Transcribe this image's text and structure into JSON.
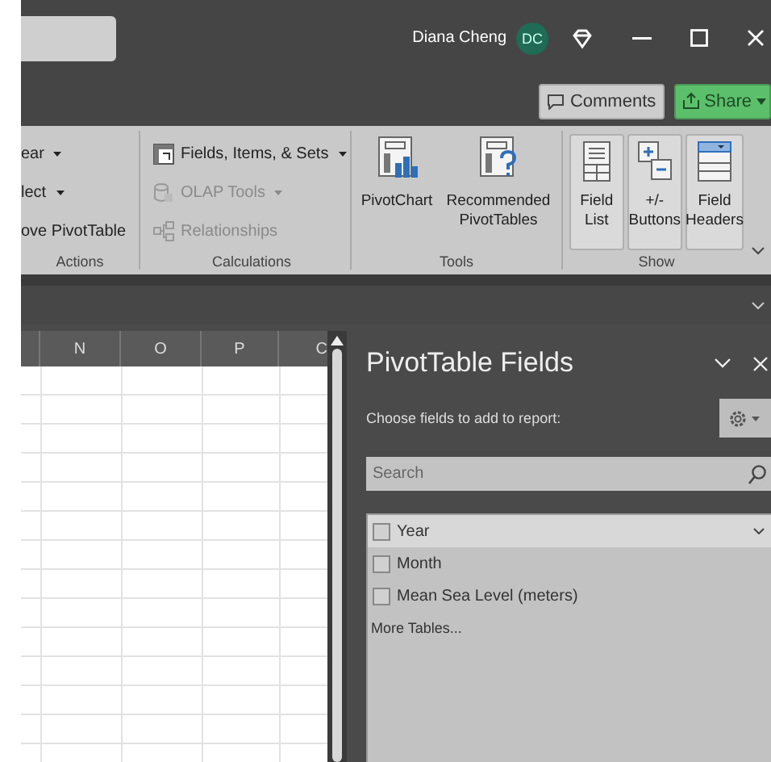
{
  "title_bar": {
    "user_name": "Diana Cheng",
    "user_initials": "DC"
  },
  "share_bar": {
    "buttons": [
      {
        "label": "Comments",
        "kind": "comments"
      },
      {
        "label": "Share",
        "kind": "share"
      }
    ]
  },
  "ribbon": {
    "groups": [
      {
        "label": "Actions",
        "kind": "list",
        "items": [
          {
            "label": "ear",
            "dropdown": true,
            "disabled": false
          },
          {
            "label": "lect",
            "dropdown": true,
            "disabled": false
          },
          {
            "label": "ove PivotTable",
            "dropdown": false,
            "disabled": false
          }
        ]
      },
      {
        "label": "Calculations",
        "kind": "list",
        "items": [
          {
            "label": "Fields, Items, & Sets",
            "kind": "fields",
            "dropdown": true,
            "disabled": false
          },
          {
            "label": "OLAP Tools",
            "kind": "olap",
            "dropdown": true,
            "disabled": true
          },
          {
            "label": "Relationships",
            "kind": "relationships",
            "dropdown": false,
            "disabled": true
          }
        ]
      },
      {
        "label": "Tools",
        "kind": "large",
        "items": [
          {
            "label": "PivotChart",
            "kind": "chart"
          },
          {
            "label": "Recommended PivotTables",
            "kind": "recommended"
          }
        ]
      },
      {
        "label": "Show",
        "kind": "toggle",
        "items": [
          {
            "label": "Field List",
            "kind": "list",
            "selected": true
          },
          {
            "label": "+/- Buttons",
            "kind": "buttons",
            "selected": true
          },
          {
            "label": "Field Headers",
            "kind": "headers",
            "selected": true
          }
        ]
      }
    ]
  },
  "sheet": {
    "columns": [
      "N",
      "O",
      "P",
      "C"
    ]
  },
  "pivot_pane": {
    "title": "PivotTable Fields",
    "subtitle": "Choose fields to add to report:",
    "search": {
      "placeholder": "Search"
    },
    "fields": [
      {
        "name": "Year",
        "checked": false,
        "selected": true
      },
      {
        "name": "Month",
        "checked": false,
        "selected": false
      },
      {
        "name": "Mean Sea Level (meters)",
        "checked": false,
        "selected": false
      }
    ],
    "more_link": "More Tables..."
  }
}
